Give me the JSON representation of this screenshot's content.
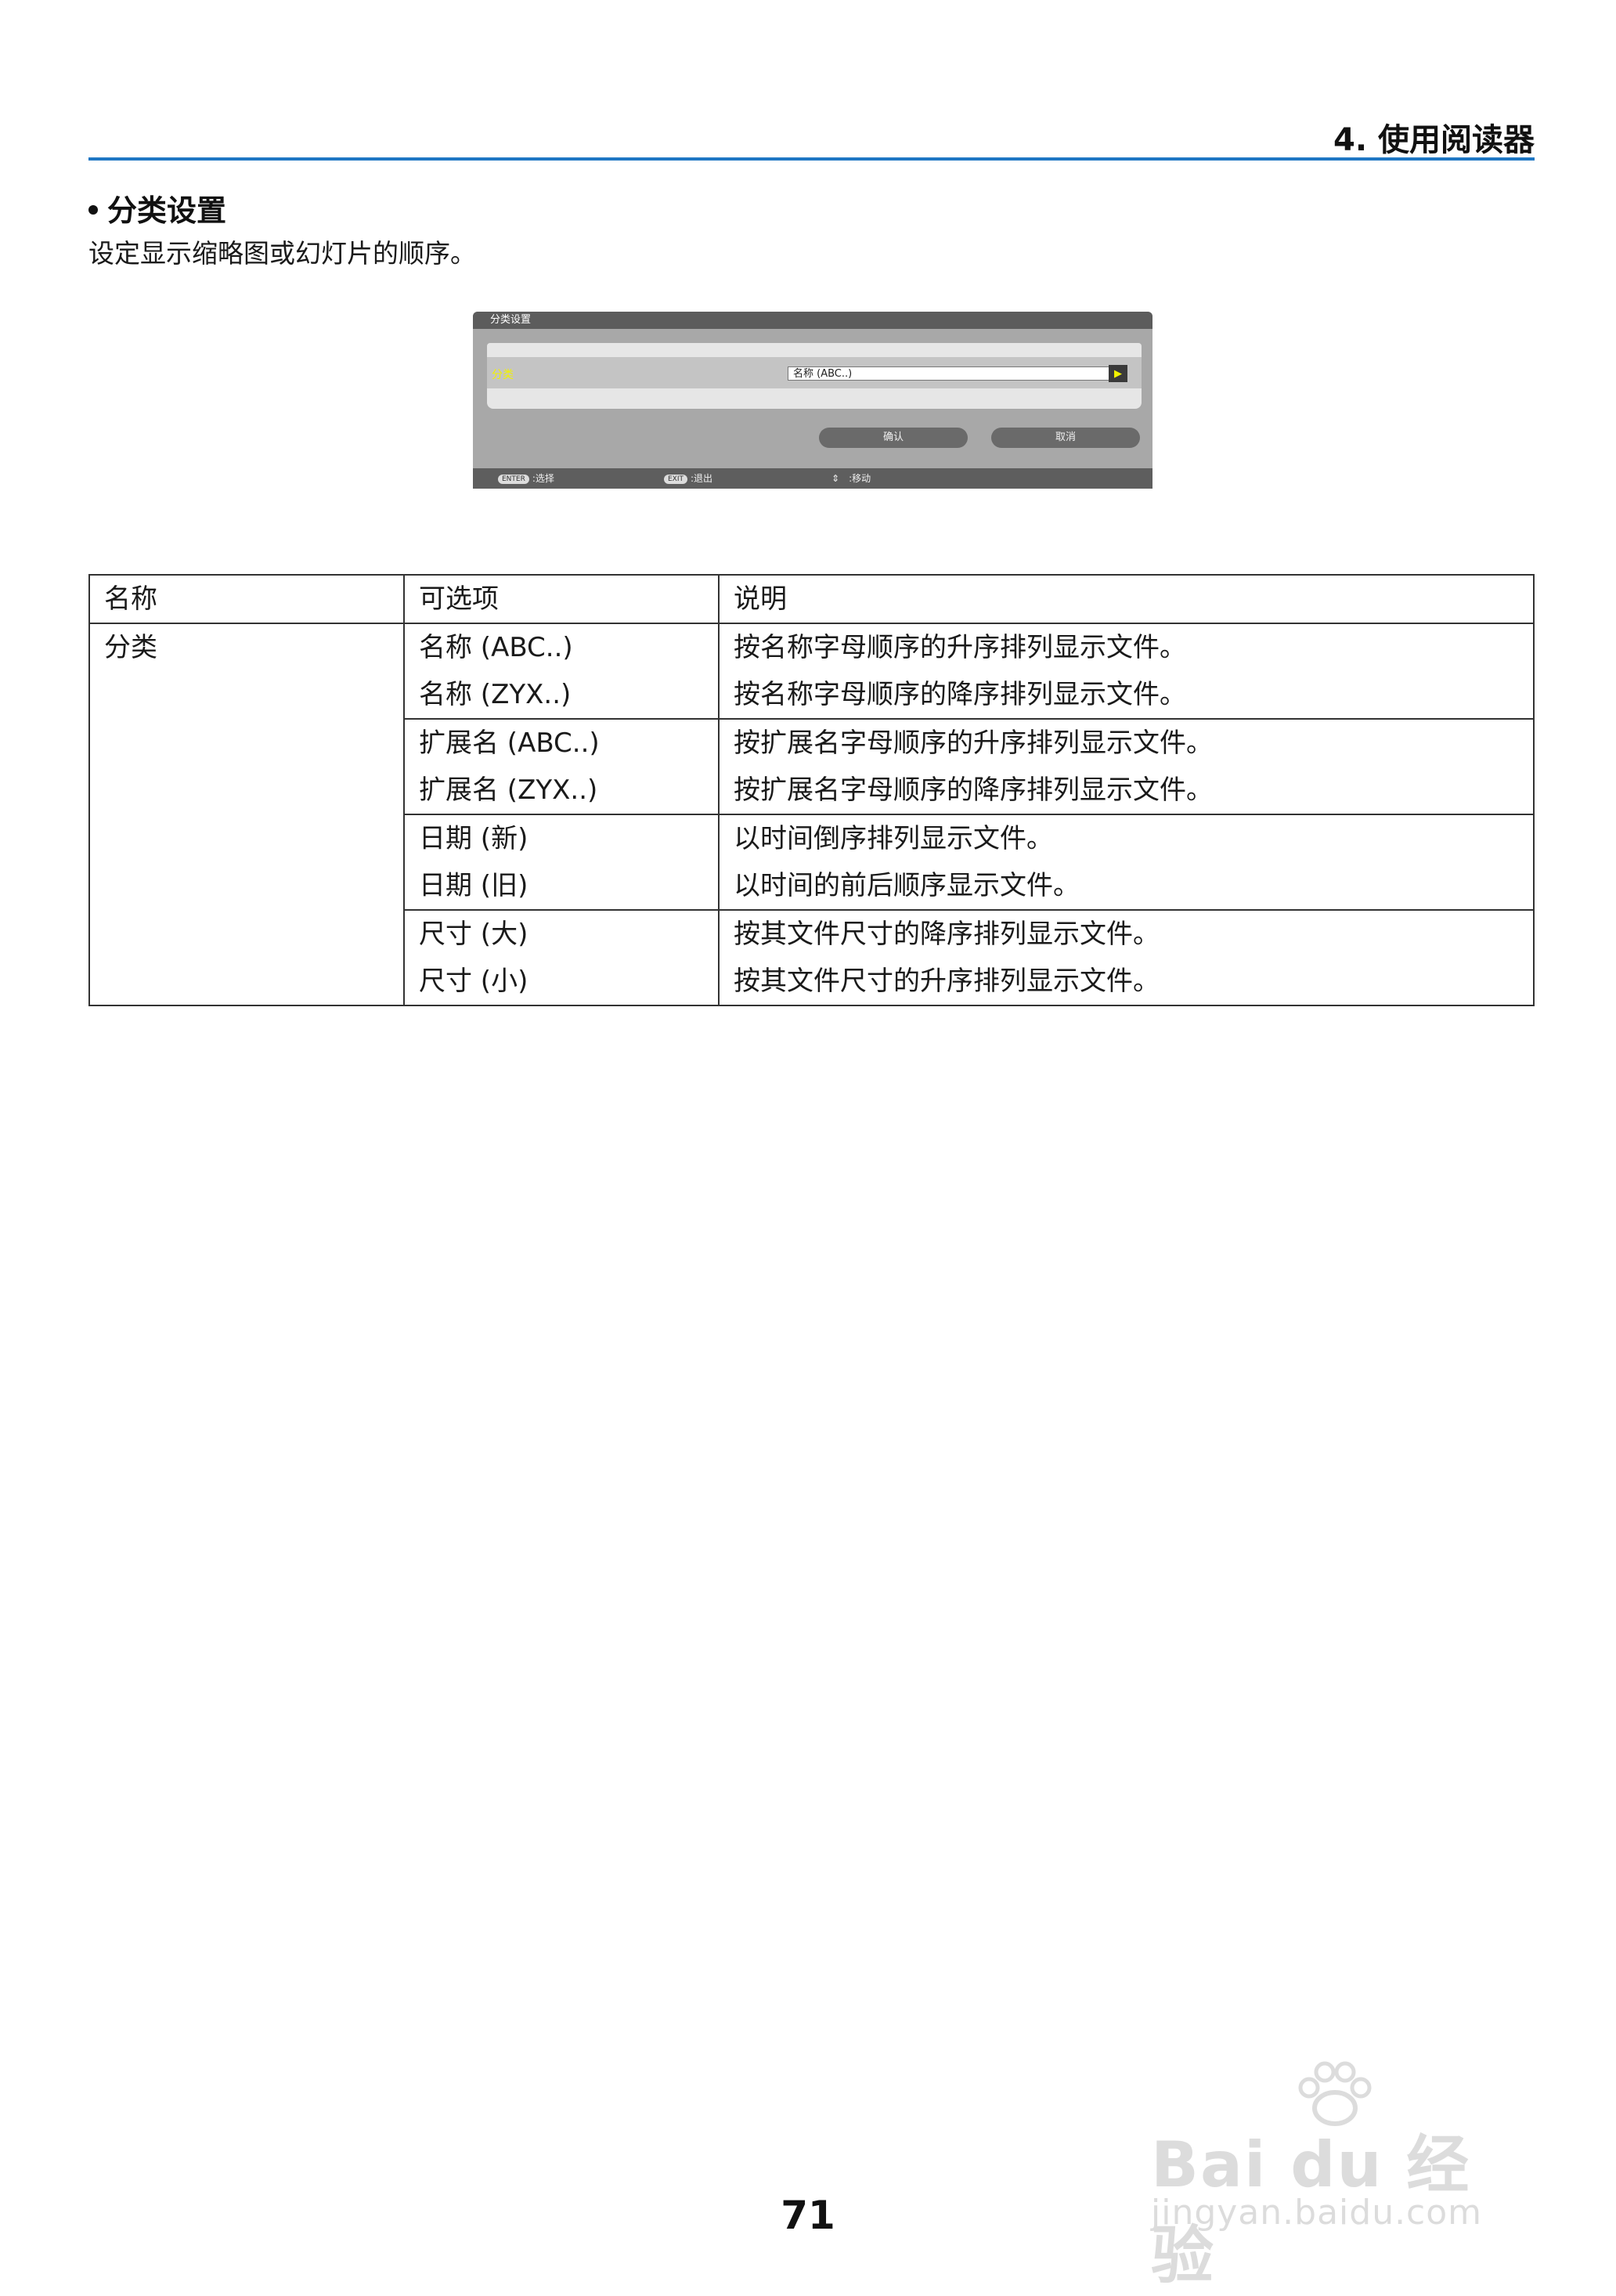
{
  "header": {
    "chapter": "4. 使用阅读器"
  },
  "section": {
    "title": "分类设置",
    "intro": "设定显示缩略图或幻灯片的顺序。"
  },
  "dialog": {
    "title": "分类设置",
    "label": "分类",
    "value": "名称 (ABC..)",
    "ok_label": "确认",
    "cancel_label": "取消",
    "footer": [
      {
        "key": "ENTER",
        "text": ":选择"
      },
      {
        "key": "EXIT",
        "text": ":退出"
      },
      {
        "key": "⇕",
        "text": ":移动"
      }
    ]
  },
  "table": {
    "headers": [
      "名称",
      "可选项",
      "说明"
    ],
    "name": "分类",
    "groups": [
      {
        "options": [
          "名称 (ABC..)",
          "名称 (ZYX..)"
        ],
        "descriptions": [
          "按名称字母顺序的升序排列显示文件。",
          "按名称字母顺序的降序排列显示文件。"
        ]
      },
      {
        "options": [
          "扩展名 (ABC..)",
          "扩展名 (ZYX..)"
        ],
        "descriptions": [
          "按扩展名字母顺序的升序排列显示文件。",
          "按扩展名字母顺序的降序排列显示文件。"
        ]
      },
      {
        "options": [
          "日期 (新)",
          "日期 (旧)"
        ],
        "descriptions": [
          "以时间倒序排列显示文件。",
          "以时间的前后顺序显示文件。"
        ]
      },
      {
        "options": [
          "尺寸 (大)",
          "尺寸 (小)"
        ],
        "descriptions": [
          "按其文件尺寸的降序排列显示文件。",
          "按其文件尺寸的升序排列显示文件。"
        ]
      }
    ]
  },
  "page_number": "71",
  "watermark": {
    "brand": "Bai du 经验",
    "url": "jingyan.baidu.com"
  }
}
